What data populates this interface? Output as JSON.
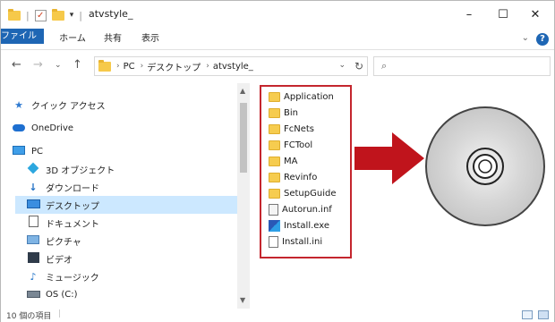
{
  "window": {
    "title": "atvstyle_",
    "controls": {
      "minimize": "–",
      "maximize": "☐",
      "close": "✕"
    }
  },
  "quick_access_toolbar": {
    "separator": "|",
    "dropdown": "▾"
  },
  "ribbon": {
    "tabs": [
      "ファイル",
      "ホーム",
      "共有",
      "表示"
    ],
    "help": "?"
  },
  "address_bar": {
    "breadcrumbs": [
      "PC",
      "デスクトップ",
      "atvstyle_"
    ],
    "separator": "›"
  },
  "search": {
    "placeholder": ""
  },
  "navigation_pane": {
    "items": [
      {
        "label": "クイック アクセス",
        "icon": "star-icon"
      },
      {
        "label": "OneDrive",
        "icon": "cloud-icon"
      },
      {
        "label": "PC",
        "icon": "computer-icon"
      },
      {
        "label": "3D オブジェクト",
        "icon": "cube-icon"
      },
      {
        "label": "ダウンロード",
        "icon": "download-icon"
      },
      {
        "label": "デスクトップ",
        "icon": "desktop-icon",
        "selected": true
      },
      {
        "label": "ドキュメント",
        "icon": "document-icon"
      },
      {
        "label": "ピクチャ",
        "icon": "pictures-icon"
      },
      {
        "label": "ビデオ",
        "icon": "video-icon"
      },
      {
        "label": "ミュージック",
        "icon": "music-icon"
      },
      {
        "label": "OS (C:)",
        "icon": "drive-icon"
      }
    ]
  },
  "files": [
    {
      "name": "Application",
      "type": "folder"
    },
    {
      "name": "Bin",
      "type": "folder"
    },
    {
      "name": "FcNets",
      "type": "folder"
    },
    {
      "name": "FCTool",
      "type": "folder"
    },
    {
      "name": "MA",
      "type": "folder"
    },
    {
      "name": "Revinfo",
      "type": "folder"
    },
    {
      "name": "SetupGuide",
      "type": "folder"
    },
    {
      "name": "Autorun.inf",
      "type": "inf"
    },
    {
      "name": "Install.exe",
      "type": "exe"
    },
    {
      "name": "Install.ini",
      "type": "ini"
    }
  ],
  "status_bar": {
    "item_count": "10 個の項目"
  },
  "colors": {
    "accent": "#1e66b4",
    "highlight_box": "#c4262e",
    "arrow": "#c0141c",
    "selected_nav": "#cce8ff"
  }
}
